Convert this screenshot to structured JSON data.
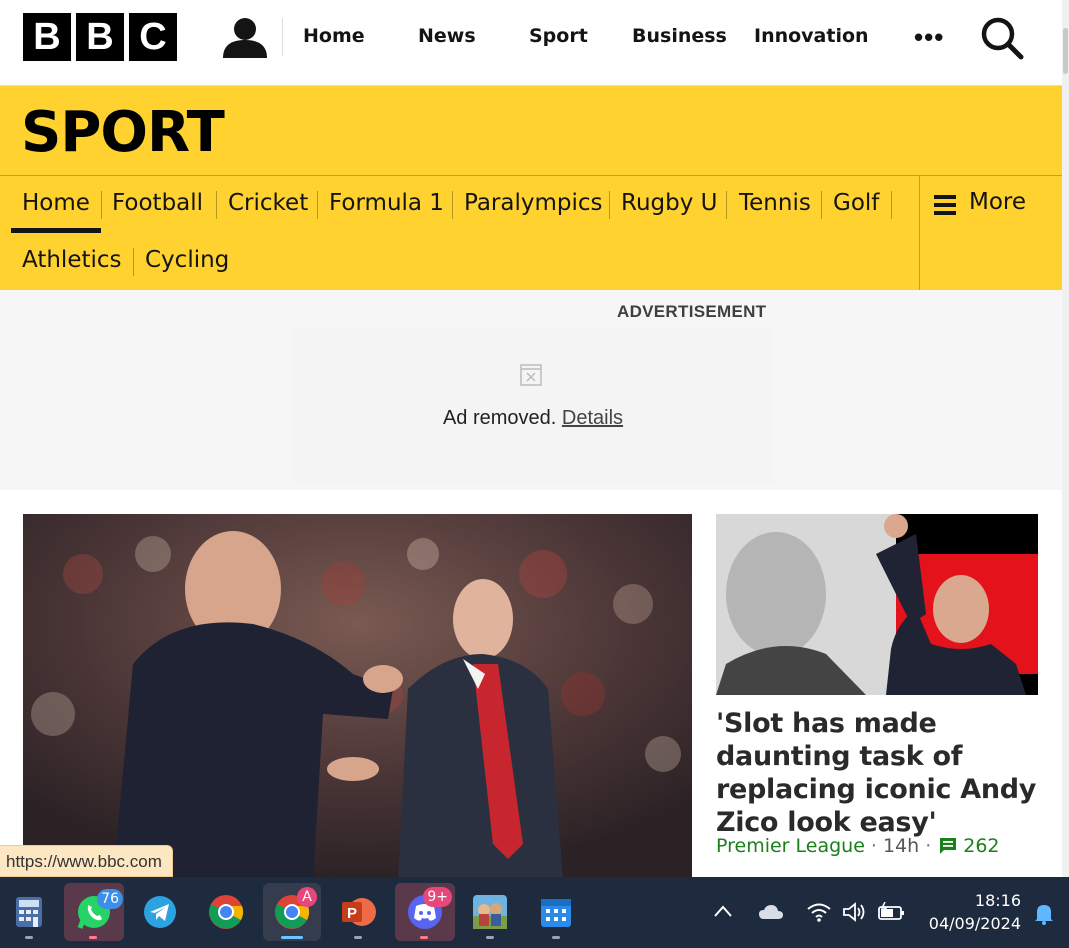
{
  "header": {
    "logo_letters": [
      "B",
      "B",
      "C"
    ],
    "nav": [
      "Home",
      "News",
      "Sport",
      "Business",
      "Innovation"
    ],
    "more_label": "•••"
  },
  "banner": {
    "title": "SPORT"
  },
  "sport_nav": {
    "items": [
      "Home",
      "Football",
      "Cricket",
      "Formula 1",
      "Paralympics",
      "Rugby U",
      "Tennis",
      "Golf",
      "Athletics",
      "Cycling"
    ],
    "active": "Home",
    "more": "More"
  },
  "ad": {
    "label": "ADVERTISEMENT",
    "removed_text": "Ad removed.",
    "details_link": "Details"
  },
  "story": {
    "headline": "'Slot has made daunting task of replacing iconic Andy Zico look easy'",
    "tag": "Premier League",
    "time": "14h",
    "comments": "262"
  },
  "status_url": "https://www.bbc.com",
  "taskbar": {
    "whatsapp_badge": "76",
    "chrome_profile_badge": "A",
    "discord_badge": "9+",
    "time": "18:16",
    "date": "04/09/2024"
  },
  "colors": {
    "sport_yellow": "#ffd230",
    "tag_green": "#1b7f1b",
    "taskbar_bg": "#1e2a3e"
  }
}
